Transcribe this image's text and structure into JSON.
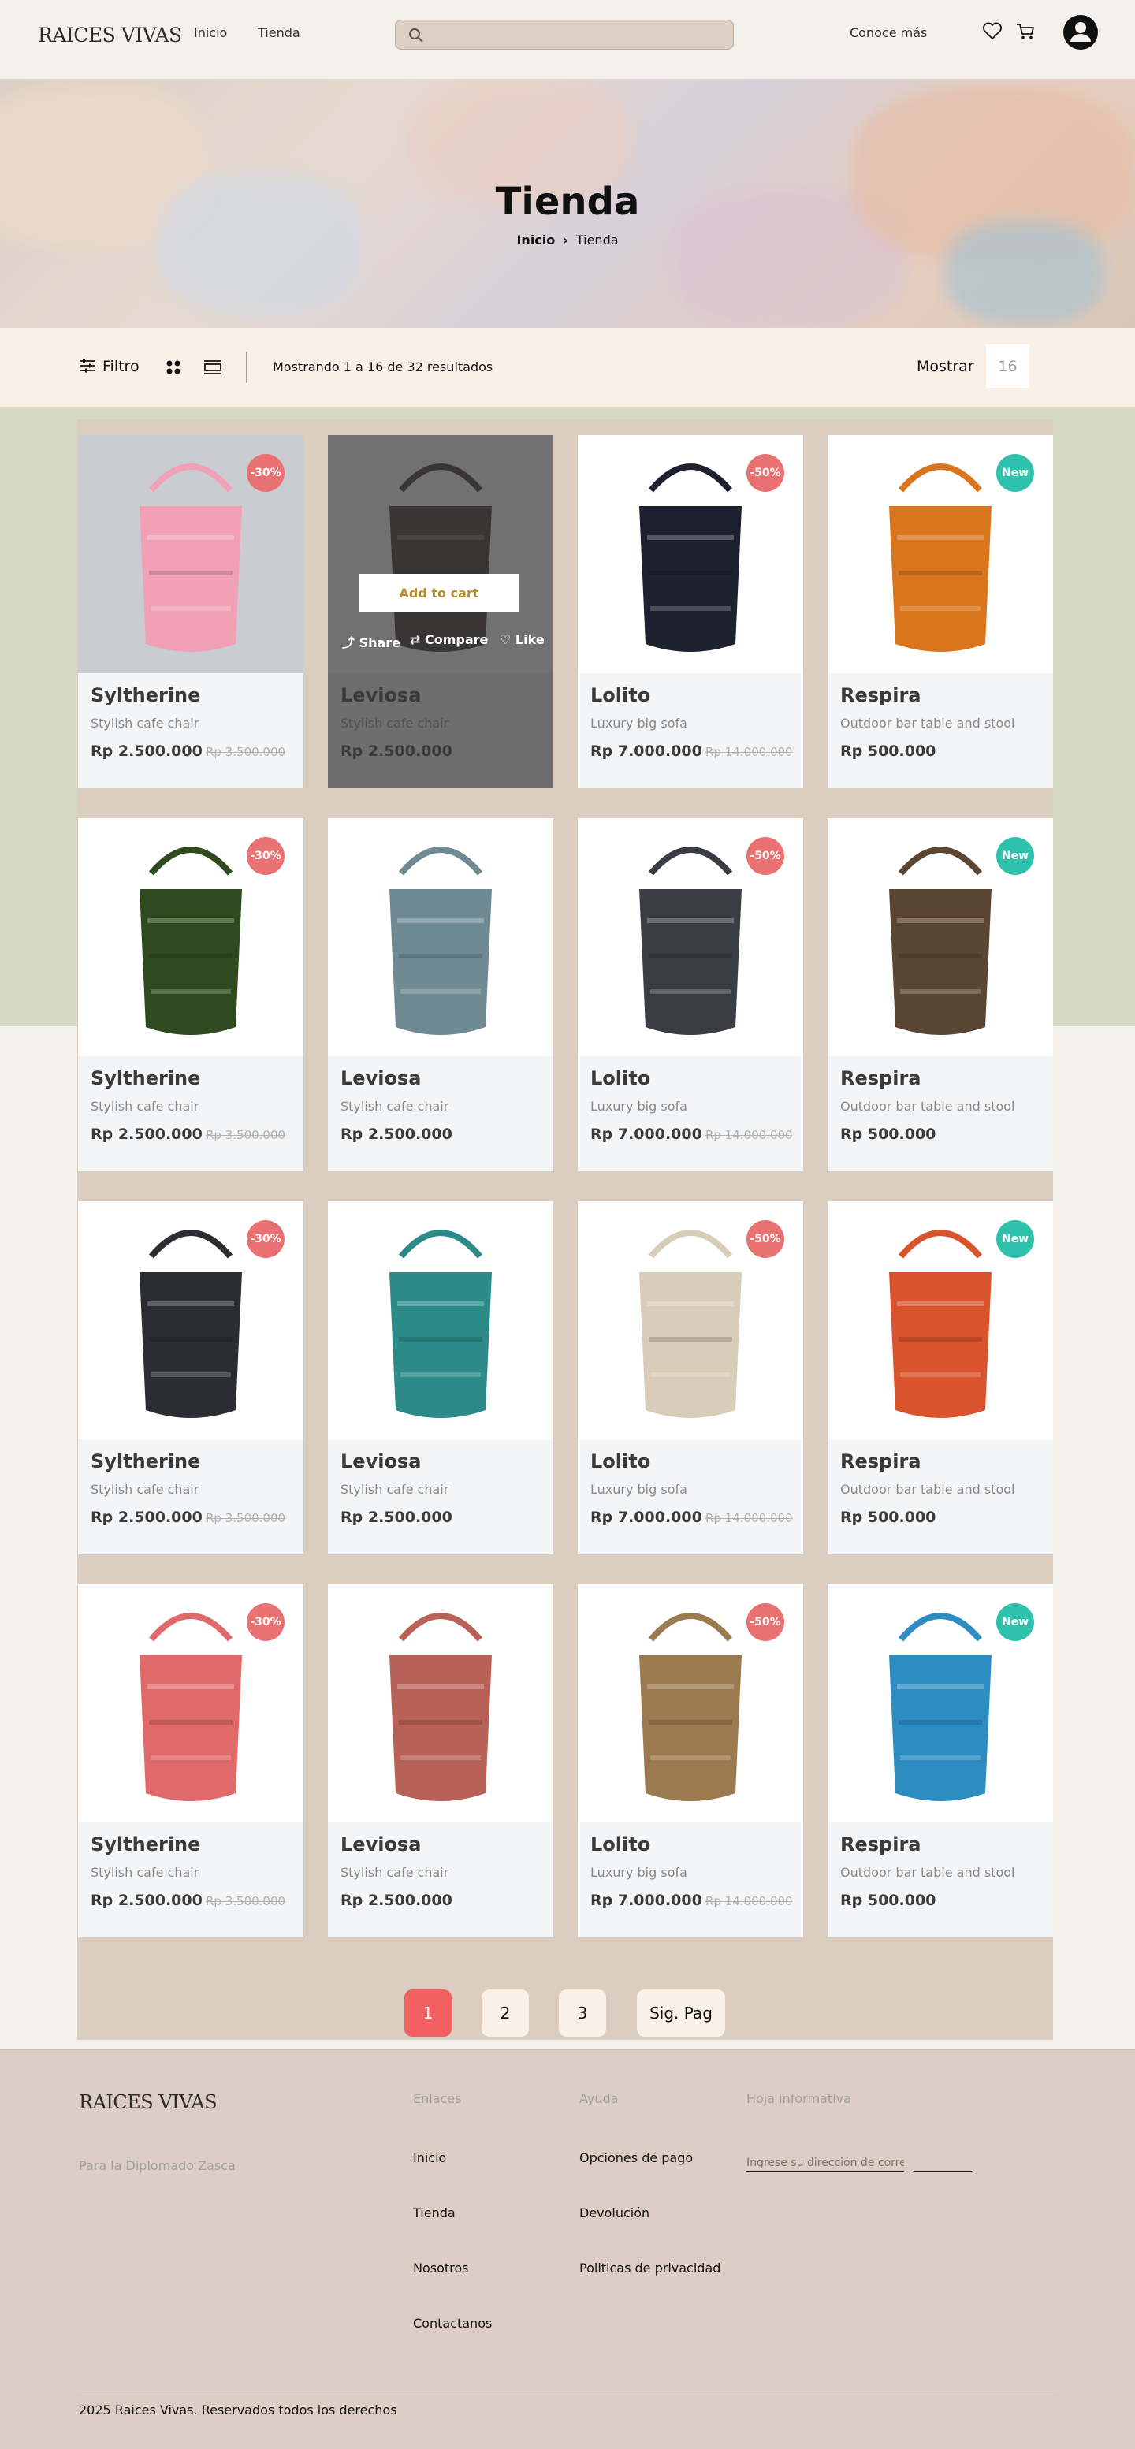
{
  "header": {
    "logo": "RAICES VIVAS",
    "nav": [
      "Inicio",
      "Tienda"
    ],
    "search_placeholder": "",
    "conoce": "Conoce más"
  },
  "hero": {
    "title": "Tienda",
    "breadcrumb": [
      "Inicio",
      "Tienda"
    ]
  },
  "filterbar": {
    "filter_label": "Filtro",
    "results": "Mostrando 1 a 16 de 32 resultados",
    "show_label": "Mostrar",
    "show_value": "16"
  },
  "products": [
    {
      "name": "Syltherine",
      "desc": "Stylish cafe chair",
      "price": "Rp 2.500.000",
      "old": "Rp 3.500.000",
      "badge": "-30%",
      "badge_type": "sale",
      "color": "#f2a0b5"
    },
    {
      "name": "Leviosa",
      "desc": "Stylish cafe chair",
      "price": "Rp 2.500.000",
      "old": "",
      "badge": "",
      "badge_type": "",
      "color": "#3a2a2a"
    },
    {
      "name": "Lolito",
      "desc": "Luxury big sofa",
      "price": "Rp 7.000.000",
      "old": "Rp 14.000.000",
      "badge": "-50%",
      "badge_type": "sale",
      "color": "#1e2230"
    },
    {
      "name": "Respira",
      "desc": "Outdoor bar table and stool",
      "price": "Rp 500.000",
      "old": "",
      "badge": "New",
      "badge_type": "new",
      "color": "#d9751c"
    },
    {
      "name": "Syltherine",
      "desc": "Stylish cafe chair",
      "price": "Rp 2.500.000",
      "old": "Rp 3.500.000",
      "badge": "-30%",
      "badge_type": "sale",
      "color": "#2f4a1f"
    },
    {
      "name": "Leviosa",
      "desc": "Stylish cafe chair",
      "price": "Rp 2.500.000",
      "old": "",
      "badge": "",
      "badge_type": "",
      "color": "#6f8a92"
    },
    {
      "name": "Lolito",
      "desc": "Luxury big sofa",
      "price": "Rp 7.000.000",
      "old": "Rp 14.000.000",
      "badge": "-50%",
      "badge_type": "sale",
      "color": "#3a3d44"
    },
    {
      "name": "Respira",
      "desc": "Outdoor bar table and stool",
      "price": "Rp 500.000",
      "old": "",
      "badge": "New",
      "badge_type": "new",
      "color": "#5a4632"
    },
    {
      "name": "Syltherine",
      "desc": "Stylish cafe chair",
      "price": "Rp 2.500.000",
      "old": "Rp 3.500.000",
      "badge": "-30%",
      "badge_type": "sale",
      "color": "#2b2d33"
    },
    {
      "name": "Leviosa",
      "desc": "Stylish cafe chair",
      "price": "Rp 2.500.000",
      "old": "",
      "badge": "",
      "badge_type": "",
      "color": "#2c8b88"
    },
    {
      "name": "Lolito",
      "desc": "Luxury big sofa",
      "price": "Rp 7.000.000",
      "old": "Rp 14.000.000",
      "badge": "-50%",
      "badge_type": "sale",
      "color": "#d8cdb8"
    },
    {
      "name": "Respira",
      "desc": "Outdoor bar table and stool",
      "price": "Rp 500.000",
      "old": "",
      "badge": "New",
      "badge_type": "new",
      "color": "#d9532d"
    },
    {
      "name": "Syltherine",
      "desc": "Stylish cafe chair",
      "price": "Rp 2.500.000",
      "old": "Rp 3.500.000",
      "badge": "-30%",
      "badge_type": "sale",
      "color": "#e06a6a"
    },
    {
      "name": "Leviosa",
      "desc": "Stylish cafe chair",
      "price": "Rp 2.500.000",
      "old": "",
      "badge": "",
      "badge_type": "",
      "color": "#b86157"
    },
    {
      "name": "Lolito",
      "desc": "Luxury big sofa",
      "price": "Rp 7.000.000",
      "old": "Rp 14.000.000",
      "badge": "-50%",
      "badge_type": "sale",
      "color": "#9a7a4e"
    },
    {
      "name": "Respira",
      "desc": "Outdoor bar table and stool",
      "price": "Rp 500.000",
      "old": "",
      "badge": "New",
      "badge_type": "new",
      "color": "#2d8cc2"
    }
  ],
  "hover_card": {
    "add_to_cart": "Add to cart",
    "share": "Share",
    "compare": "Compare",
    "like": "Like"
  },
  "pagination": [
    "1",
    "2",
    "3",
    "Sig. Pag"
  ],
  "footer": {
    "logo": "RAICES VIVAS",
    "subtitle": "Para la Diplomado Zasca",
    "links_heading": "Enlaces",
    "links": [
      "Inicio",
      "Tienda",
      "Nosotros",
      "Contactanos"
    ],
    "help_heading": "Ayuda",
    "help": [
      "Opciones de pago",
      "Devolución",
      "Politicas de privacidad"
    ],
    "newsletter_heading": "Hoja informativa",
    "newsletter_placeholder": "Ingrese su dirección de correo electrónico",
    "newsletter_button": "",
    "copyright": "2025 Raices Vivas. Reservados todos los derechos"
  },
  "colors": {
    "accent": "#b88e2f",
    "sale_badge": "#e97171",
    "new_badge": "#2ec1ac",
    "active_page": "#f26061"
  }
}
